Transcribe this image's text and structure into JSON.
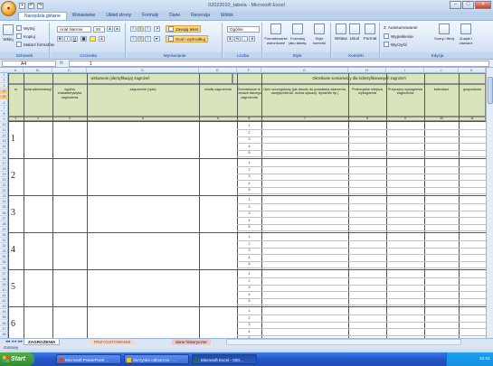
{
  "window": {
    "title": "02022010_tabela - Microsoft Excel"
  },
  "ribbon_tabs": [
    "Narzędzia główne",
    "Wstawianie",
    "Układ strony",
    "Formuły",
    "Dane",
    "Recenzja",
    "Widok"
  ],
  "ribbon": {
    "clipboard": {
      "paste": "Wklej",
      "cut": "Wytnij",
      "copy": "Kopiuj",
      "format_painter": "Malarz formatów",
      "label": "Schowek"
    },
    "font": {
      "name": "Arial Narrow",
      "size": "20",
      "label": "Czcionka"
    },
    "alignment": {
      "wrap": "Zawijaj tekst",
      "merge": "Scal i wyśrodkuj",
      "label": "Wyrównanie"
    },
    "number": {
      "format": "Ogólne",
      "label": "Liczba"
    },
    "styles": {
      "cond": "Formatowanie warunkowe",
      "table": "Formatuj jako tabelę",
      "cell": "Style komórki",
      "label": "Style"
    },
    "cells": {
      "insert": "Wstaw",
      "delete": "Usuń",
      "format": "Format",
      "label": "Komórki"
    },
    "editing": {
      "autosum": "Autosumowanie",
      "fill": "Wypełnienie",
      "clear": "Wyczyść",
      "sort": "Sortuj i filtruj",
      "find": "Znajdź i zaznacz",
      "label": "Edycja"
    }
  },
  "formula_bar": {
    "cell_ref": "A4",
    "fx": "fx",
    "value": "1"
  },
  "columns": [
    "A",
    "B",
    "C",
    "D",
    "E",
    "F",
    "G",
    "H",
    "I",
    "J",
    "K"
  ],
  "sheet": {
    "group_header_left": "wskazanie (identyfikacja) zagrożeń",
    "group_header_right": "Określanie scenariuszy dla zidentyfikowanych zagrożeń",
    "headers": [
      "nr",
      "dział administracji",
      "ogólna charakterystyka zagrożenia",
      "zagrożenie (opis)",
      "źródły zagrożenia",
      "Scenariusze w ramach danego zagrożenia",
      "Opis szczegółowy (jak doszło do powstania zdarzenia, uwzględnienia, ocena sytuacji, dynamiki itp.)",
      "Potencjalne miejsca wystąpienia",
      "Przyczyny wystąpienia zagrożenia",
      "kalendarz",
      "gospodarka"
    ],
    "col_numbers": [
      "1",
      "2",
      "3",
      "4",
      "5",
      "6",
      "7",
      "8",
      "9",
      "10",
      "11"
    ],
    "row_numbers": [
      "1",
      "2",
      "3",
      "4",
      "5",
      "6"
    ],
    "scenario_numbers": [
      "1",
      "2",
      "3",
      "4",
      "5"
    ]
  },
  "row_headers": [
    "1",
    "2",
    "3",
    "4",
    "5",
    "6",
    "7",
    "8",
    "9",
    "10",
    "11",
    "12",
    "13",
    "14",
    "15",
    "16",
    "17",
    "18",
    "19",
    "20",
    "21",
    "22",
    "23",
    "24",
    "25",
    "26",
    "27",
    "28",
    "29",
    "30",
    "31",
    "32",
    "33",
    "34",
    "35",
    "36",
    "37",
    "38",
    "39",
    "40",
    "41",
    "42",
    "43",
    "44",
    "45",
    "46",
    "47",
    "48"
  ],
  "sheet_tabs": [
    "ZAGROŻENIA",
    "PRZYGOTOWANIE",
    "dane historyczne"
  ],
  "status_bar": {
    "ready": "Gotowy"
  },
  "taskbar": {
    "start": "Start",
    "tasks": [
      "Microsoft PowerPoint ...",
      "Skrzynka odbiorcza - ...",
      "Microsoft Excel - 020..."
    ],
    "clock": "22:41"
  }
}
